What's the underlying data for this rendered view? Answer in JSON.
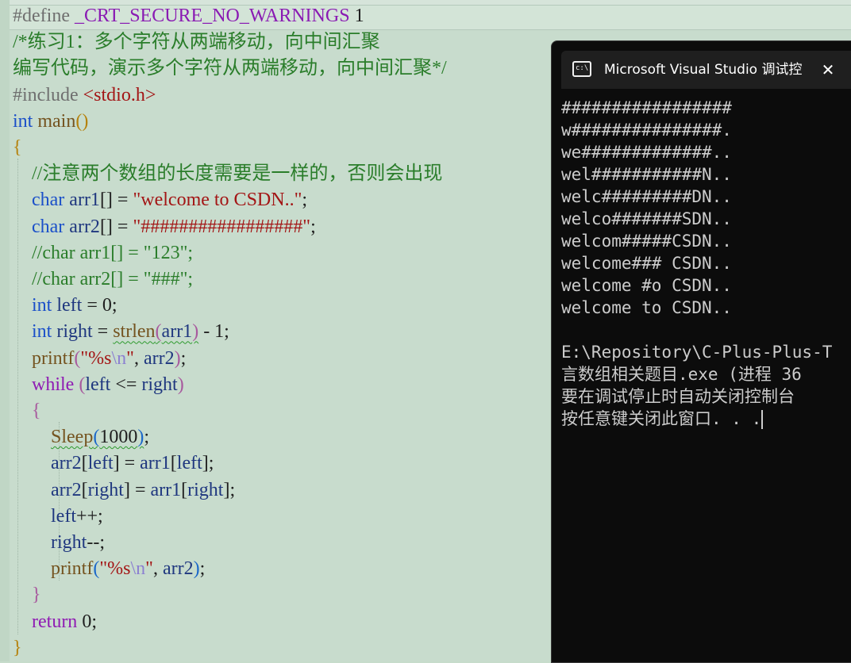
{
  "editor": {
    "lines": [
      {
        "tokens": [
          {
            "t": "#define",
            "c": "pp"
          },
          {
            "t": " "
          },
          {
            "t": "_CRT_SECURE_NO_WARNINGS",
            "c": "macro"
          },
          {
            "t": " 1",
            "c": "num"
          }
        ]
      },
      {
        "tokens": [
          {
            "t": "/*练习1：多个字符从两端移动，向中间汇聚",
            "c": "cm"
          }
        ]
      },
      {
        "tokens": [
          {
            "t": "编写代码，演示多个字符从两端移动，向中间汇聚*/",
            "c": "cm"
          }
        ]
      },
      {
        "tokens": [
          {
            "t": "#include",
            "c": "pp"
          },
          {
            "t": " "
          },
          {
            "t": "<stdio.h>",
            "c": "incl"
          }
        ]
      },
      {
        "tokens": [
          {
            "t": "int",
            "c": "kw"
          },
          {
            "t": " "
          },
          {
            "t": "main",
            "c": "fn"
          },
          {
            "t": "()",
            "c": "br1"
          }
        ]
      },
      {
        "tokens": [
          {
            "t": "{",
            "c": "br1"
          }
        ]
      },
      {
        "tokens": [
          {
            "t": "    "
          },
          {
            "t": "//注意两个数组的长度需要是一样的，否则会出现",
            "c": "cm"
          }
        ]
      },
      {
        "tokens": [
          {
            "t": "    "
          },
          {
            "t": "char",
            "c": "kw"
          },
          {
            "t": " "
          },
          {
            "t": "arr1",
            "c": "var"
          },
          {
            "t": "[] = "
          },
          {
            "t": "\"welcome to CSDN..\"",
            "c": "str"
          },
          {
            "t": ";"
          }
        ]
      },
      {
        "tokens": [
          {
            "t": "    "
          },
          {
            "t": "char",
            "c": "kw"
          },
          {
            "t": " "
          },
          {
            "t": "arr2",
            "c": "var"
          },
          {
            "t": "[] = "
          },
          {
            "t": "\"#################\"",
            "c": "str"
          },
          {
            "t": ";"
          }
        ]
      },
      {
        "tokens": [
          {
            "t": "    "
          },
          {
            "t": "//char arr1[] = \"123\";",
            "c": "cm"
          }
        ]
      },
      {
        "tokens": [
          {
            "t": "    "
          },
          {
            "t": "//char arr2[] = \"###\";",
            "c": "cm"
          }
        ]
      },
      {
        "tokens": [
          {
            "t": "    "
          },
          {
            "t": "int",
            "c": "kw"
          },
          {
            "t": " "
          },
          {
            "t": "left",
            "c": "var"
          },
          {
            "t": " = 0;"
          }
        ]
      },
      {
        "tokens": [
          {
            "t": "    "
          },
          {
            "t": "int",
            "c": "kw"
          },
          {
            "t": " "
          },
          {
            "t": "right",
            "c": "var"
          },
          {
            "t": " = "
          },
          {
            "t": "strlen",
            "c": "fn squig"
          },
          {
            "t": "(",
            "c": "br2 squig"
          },
          {
            "t": "arr1",
            "c": "var squig"
          },
          {
            "t": ")",
            "c": "br2 squig"
          },
          {
            "t": " - 1;"
          }
        ]
      },
      {
        "tokens": [
          {
            "t": "    "
          },
          {
            "t": "printf",
            "c": "fn"
          },
          {
            "t": "(",
            "c": "br2"
          },
          {
            "t": "\"%s",
            "c": "str"
          },
          {
            "t": "\\n",
            "c": "esc"
          },
          {
            "t": "\"",
            "c": "str"
          },
          {
            "t": ", "
          },
          {
            "t": "arr2",
            "c": "var"
          },
          {
            "t": ")",
            "c": "br2"
          },
          {
            "t": ";"
          }
        ]
      },
      {
        "tokens": [
          {
            "t": "    "
          },
          {
            "t": "while",
            "c": "kw2"
          },
          {
            "t": " "
          },
          {
            "t": "(",
            "c": "br2"
          },
          {
            "t": "left",
            "c": "var"
          },
          {
            "t": " <= "
          },
          {
            "t": "right",
            "c": "var"
          },
          {
            "t": ")",
            "c": "br2"
          }
        ]
      },
      {
        "tokens": [
          {
            "t": "    "
          },
          {
            "t": "{",
            "c": "br2"
          }
        ]
      },
      {
        "tokens": [
          {
            "t": "        "
          },
          {
            "t": "Sleep",
            "c": "fn squig"
          },
          {
            "t": "(",
            "c": "br3 squig"
          },
          {
            "t": "1000",
            "c": "num squig"
          },
          {
            "t": ")",
            "c": "br3 squig"
          },
          {
            "t": ";"
          }
        ]
      },
      {
        "tokens": [
          {
            "t": "        "
          },
          {
            "t": "arr2",
            "c": "var"
          },
          {
            "t": "["
          },
          {
            "t": "left",
            "c": "var"
          },
          {
            "t": "] = "
          },
          {
            "t": "arr1",
            "c": "var"
          },
          {
            "t": "["
          },
          {
            "t": "left",
            "c": "var"
          },
          {
            "t": "];"
          }
        ]
      },
      {
        "tokens": [
          {
            "t": "        "
          },
          {
            "t": "arr2",
            "c": "var"
          },
          {
            "t": "["
          },
          {
            "t": "right",
            "c": "var"
          },
          {
            "t": "] = "
          },
          {
            "t": "arr1",
            "c": "var"
          },
          {
            "t": "["
          },
          {
            "t": "right",
            "c": "var"
          },
          {
            "t": "];"
          }
        ]
      },
      {
        "tokens": [
          {
            "t": "        "
          },
          {
            "t": "left",
            "c": "var"
          },
          {
            "t": "++;"
          }
        ]
      },
      {
        "tokens": [
          {
            "t": "        "
          },
          {
            "t": "right",
            "c": "var"
          },
          {
            "t": "--;"
          }
        ]
      },
      {
        "tokens": [
          {
            "t": "        "
          },
          {
            "t": "printf",
            "c": "fn"
          },
          {
            "t": "(",
            "c": "br3"
          },
          {
            "t": "\"%s",
            "c": "str"
          },
          {
            "t": "\\n",
            "c": "esc"
          },
          {
            "t": "\"",
            "c": "str"
          },
          {
            "t": ", "
          },
          {
            "t": "arr2",
            "c": "var"
          },
          {
            "t": ")",
            "c": "br3"
          },
          {
            "t": ";"
          }
        ]
      },
      {
        "tokens": [
          {
            "t": "    "
          },
          {
            "t": "}",
            "c": "br2"
          }
        ]
      },
      {
        "tokens": [
          {
            "t": "    "
          },
          {
            "t": "return",
            "c": "kw2"
          },
          {
            "t": " 0;"
          }
        ]
      },
      {
        "tokens": [
          {
            "t": "}",
            "c": "br1"
          }
        ]
      }
    ]
  },
  "console": {
    "title": "Microsoft Visual Studio 调试控",
    "icon": "console-app-icon",
    "icon_text": "c:\\",
    "close_label": "✕",
    "output": [
      "#################",
      "w###############.",
      "we#############..",
      "wel###########N..",
      "welc#########DN..",
      "welco#######SDN..",
      "welcom#####CSDN..",
      "welcome### CSDN..",
      "welcome #o CSDN..",
      "welcome to CSDN..",
      "",
      "E:\\Repository\\C-Plus-Plus-T",
      "言数组相关题目.exe (进程 36",
      "要在调试停止时自动关闭控制台",
      "按任意键关闭此窗口. . ."
    ]
  }
}
